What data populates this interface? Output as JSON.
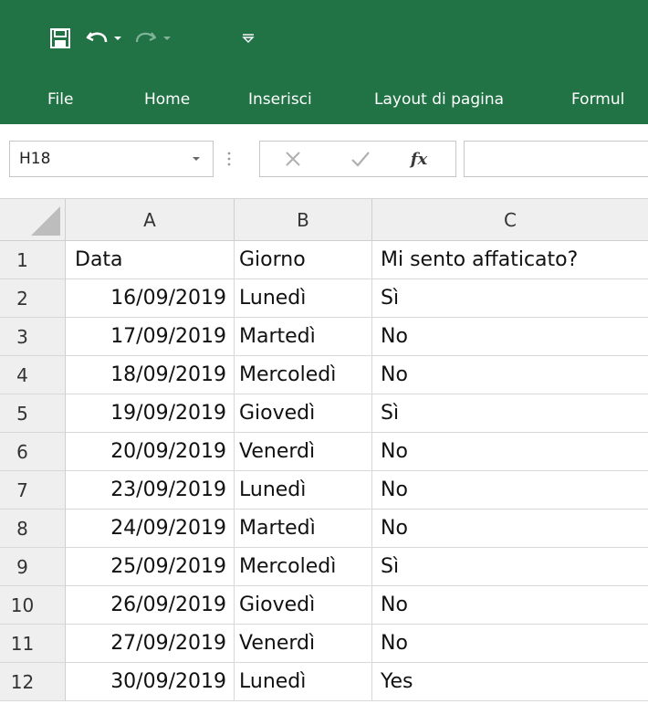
{
  "app": {
    "brand_color": "#217346",
    "qat": {
      "save_icon": "save-icon",
      "undo_icon": "undo-icon",
      "redo_icon": "redo-icon",
      "customize_icon": "customize-qat-icon"
    }
  },
  "ribbon": {
    "tabs": [
      {
        "label": "File"
      },
      {
        "label": "Home"
      },
      {
        "label": "Inserisci"
      },
      {
        "label": "Layout di pagina"
      },
      {
        "label": "Formul"
      }
    ]
  },
  "formula_bar": {
    "name_box": "H18",
    "fx_label": "fx",
    "value": ""
  },
  "sheet": {
    "columns": [
      "A",
      "B",
      "C"
    ],
    "rows": [
      {
        "num": "1",
        "a": "Data",
        "b": "Giorno",
        "c": "Mi sento affaticato?"
      },
      {
        "num": "2",
        "a": "16/09/2019",
        "b": "Lunedì",
        "c": "Sì"
      },
      {
        "num": "3",
        "a": "17/09/2019",
        "b": "Martedì",
        "c": "No"
      },
      {
        "num": "4",
        "a": "18/09/2019",
        "b": "Mercoledì",
        "c": "No"
      },
      {
        "num": "5",
        "a": "19/09/2019",
        "b": "Giovedì",
        "c": "Sì"
      },
      {
        "num": "6",
        "a": "20/09/2019",
        "b": "Venerdì",
        "c": "No"
      },
      {
        "num": "7",
        "a": "23/09/2019",
        "b": "Lunedì",
        "c": "No"
      },
      {
        "num": "8",
        "a": "24/09/2019",
        "b": "Martedì",
        "c": "No"
      },
      {
        "num": "9",
        "a": "25/09/2019",
        "b": "Mercoledì",
        "c": "Sì"
      },
      {
        "num": "10",
        "a": "26/09/2019",
        "b": "Giovedì",
        "c": "No"
      },
      {
        "num": "11",
        "a": "27/09/2019",
        "b": "Venerdì",
        "c": "No"
      },
      {
        "num": "12",
        "a": "30/09/2019",
        "b": "Lunedì",
        "c": "Yes"
      }
    ]
  }
}
